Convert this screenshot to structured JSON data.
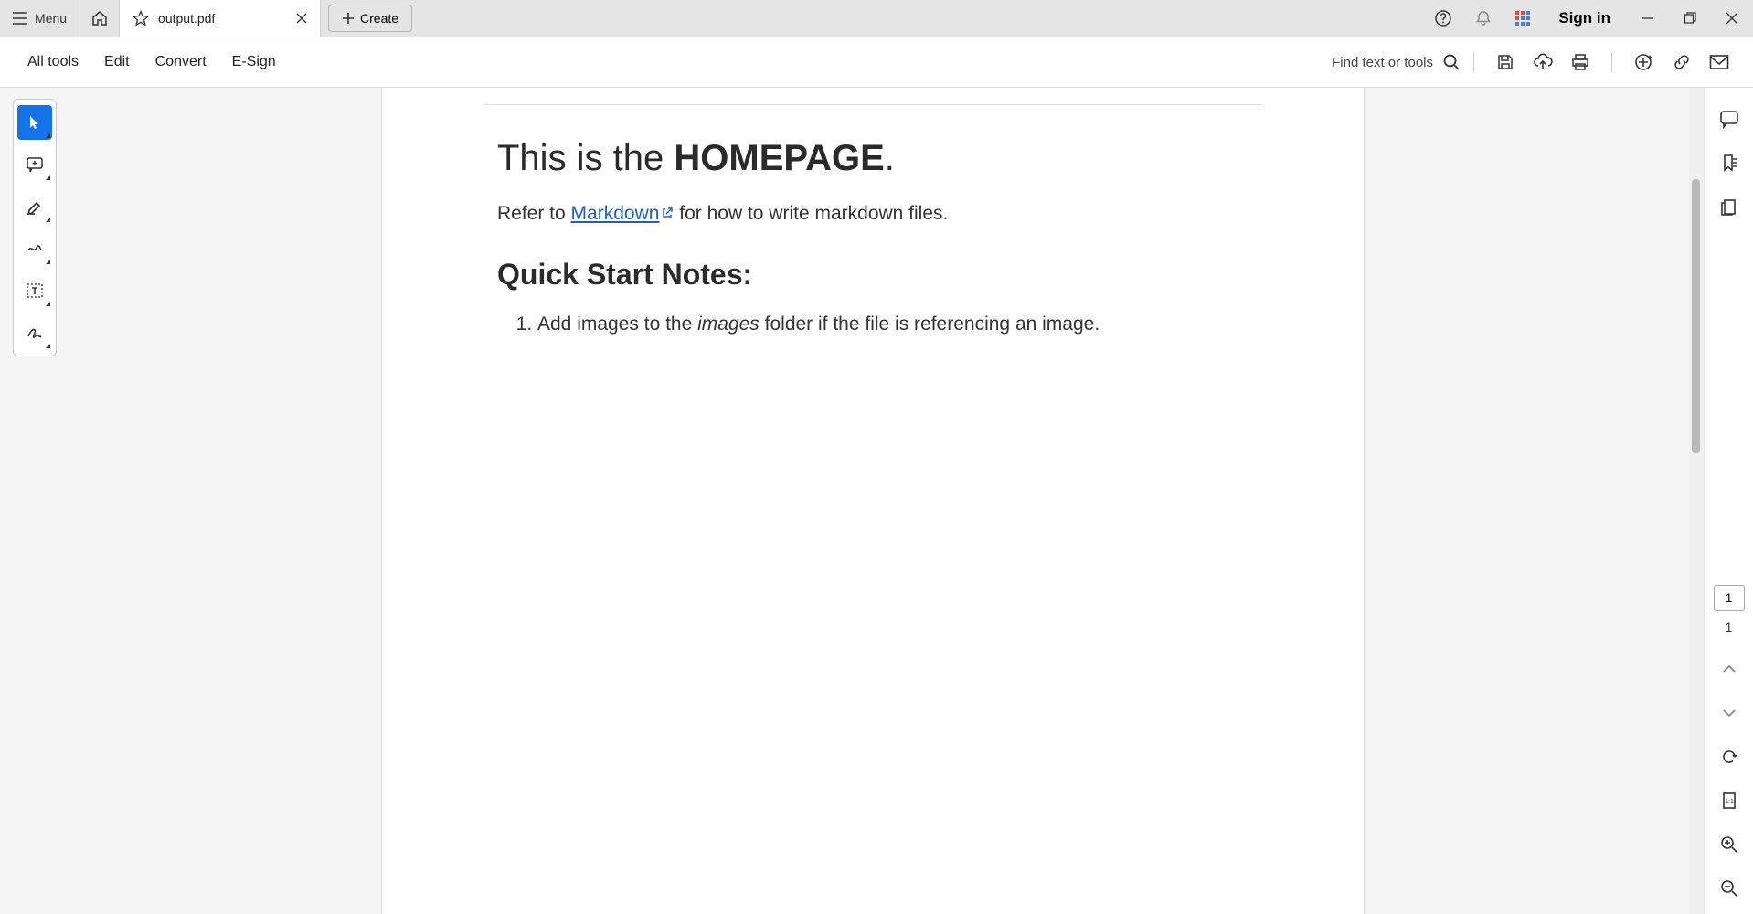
{
  "titlebar": {
    "menu_label": "Menu",
    "tab_title": "output.pdf",
    "create_label": "Create",
    "signin_label": "Sign in"
  },
  "toolbar": {
    "items": [
      "All tools",
      "Edit",
      "Convert",
      "E-Sign"
    ],
    "search_label": "Find text or tools"
  },
  "document": {
    "h1_prefix": "This is the ",
    "h1_bold": "HOMEPAGE",
    "h1_suffix": ".",
    "ref_prefix": "Refer to ",
    "ref_link": "Markdown",
    "ref_suffix": " for how to write markdown files.",
    "h2": "Quick Start Notes:",
    "list_item_prefix": "Add images to the ",
    "list_item_italic": "images",
    "list_item_suffix": " folder if the file is referencing an image."
  },
  "rightbar": {
    "page_current": "1",
    "page_total": "1"
  }
}
